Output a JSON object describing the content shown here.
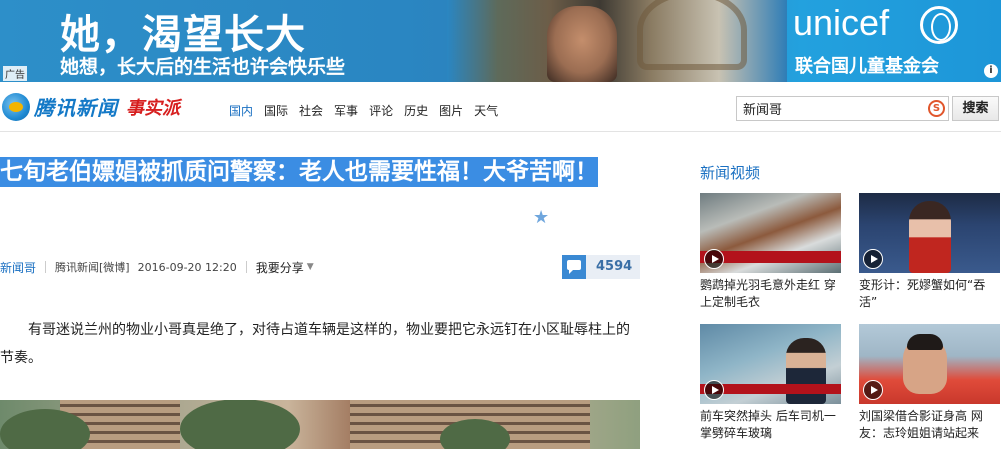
{
  "banner": {
    "headline": "她，渴望长大",
    "subline": "她想，长大后的生活也许会快乐些",
    "brand": "unicef",
    "brand_cn": "联合国儿童基金会",
    "ad_tag": "广告",
    "info": "i"
  },
  "nav": {
    "logo_text": "腾讯新闻",
    "logo_sub": "事实派",
    "links": [
      "国内",
      "国际",
      "社会",
      "军事",
      "评论",
      "历史",
      "图片",
      "天气"
    ],
    "active_link": "国内",
    "search_value": "新闻哥",
    "search_button": "搜索"
  },
  "article": {
    "title": "七旬老伯嫖娼被抓质问警察：老人也需要性福！大爷苦啊！",
    "column": "新闻哥",
    "source": "腾讯新闻[微博]",
    "time": "2016-09-20 12:20",
    "share": "我要分享",
    "comment_count": "4594",
    "paragraph": "有哥迷说兰州的物业小哥真是绝了，对待占道车辆是这样的，物业要把它永远钉在小区耻辱柱上的节奏。"
  },
  "sidebar": {
    "title": "新闻视频",
    "videos": [
      {
        "caption": "鹦鹉掉光羽毛意外走红 穿上定制毛衣"
      },
      {
        "caption": "变形计：死嫪蟹如何“吞活”"
      },
      {
        "caption": "前车突然掉头 后车司机一掌劈碎车玻璃"
      },
      {
        "caption": "刘国梁借合影证身高 网友：志玲姐姐请站起来"
      }
    ]
  },
  "colors": {
    "accent_blue": "#1a70c2",
    "selection": "#3b8de3",
    "logo_red": "#d71f1f"
  }
}
